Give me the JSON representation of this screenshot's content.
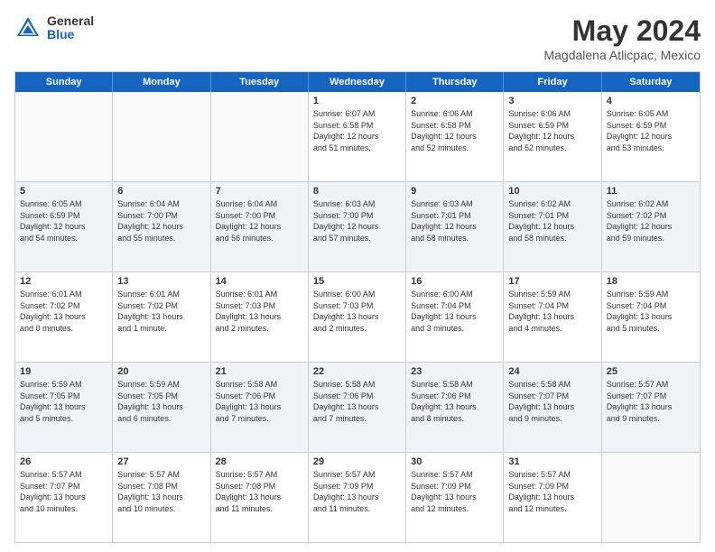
{
  "header": {
    "logo_general": "General",
    "logo_blue": "Blue",
    "month_title": "May 2024",
    "location": "Magdalena Atlicpac, Mexico"
  },
  "calendar": {
    "days_of_week": [
      "Sunday",
      "Monday",
      "Tuesday",
      "Wednesday",
      "Thursday",
      "Friday",
      "Saturday"
    ],
    "rows": [
      {
        "alt": false,
        "cells": [
          {
            "day": "",
            "empty": true,
            "text": ""
          },
          {
            "day": "",
            "empty": true,
            "text": ""
          },
          {
            "day": "",
            "empty": true,
            "text": ""
          },
          {
            "day": "1",
            "empty": false,
            "text": "Sunrise: 6:07 AM\nSunset: 6:58 PM\nDaylight: 12 hours\nand 51 minutes."
          },
          {
            "day": "2",
            "empty": false,
            "text": "Sunrise: 6:06 AM\nSunset: 6:58 PM\nDaylight: 12 hours\nand 52 minutes."
          },
          {
            "day": "3",
            "empty": false,
            "text": "Sunrise: 6:06 AM\nSunset: 6:59 PM\nDaylight: 12 hours\nand 52 minutes."
          },
          {
            "day": "4",
            "empty": false,
            "text": "Sunrise: 6:05 AM\nSunset: 6:59 PM\nDaylight: 12 hours\nand 53 minutes."
          }
        ]
      },
      {
        "alt": true,
        "cells": [
          {
            "day": "5",
            "empty": false,
            "text": "Sunrise: 6:05 AM\nSunset: 6:59 PM\nDaylight: 12 hours\nand 54 minutes."
          },
          {
            "day": "6",
            "empty": false,
            "text": "Sunrise: 6:04 AM\nSunset: 7:00 PM\nDaylight: 12 hours\nand 55 minutes."
          },
          {
            "day": "7",
            "empty": false,
            "text": "Sunrise: 6:04 AM\nSunset: 7:00 PM\nDaylight: 12 hours\nand 56 minutes."
          },
          {
            "day": "8",
            "empty": false,
            "text": "Sunrise: 6:03 AM\nSunset: 7:00 PM\nDaylight: 12 hours\nand 57 minutes."
          },
          {
            "day": "9",
            "empty": false,
            "text": "Sunrise: 6:03 AM\nSunset: 7:01 PM\nDaylight: 12 hours\nand 58 minutes."
          },
          {
            "day": "10",
            "empty": false,
            "text": "Sunrise: 6:02 AM\nSunset: 7:01 PM\nDaylight: 12 hours\nand 58 minutes."
          },
          {
            "day": "11",
            "empty": false,
            "text": "Sunrise: 6:02 AM\nSunset: 7:02 PM\nDaylight: 12 hours\nand 59 minutes."
          }
        ]
      },
      {
        "alt": false,
        "cells": [
          {
            "day": "12",
            "empty": false,
            "text": "Sunrise: 6:01 AM\nSunset: 7:02 PM\nDaylight: 13 hours\nand 0 minutes."
          },
          {
            "day": "13",
            "empty": false,
            "text": "Sunrise: 6:01 AM\nSunset: 7:02 PM\nDaylight: 13 hours\nand 1 minute."
          },
          {
            "day": "14",
            "empty": false,
            "text": "Sunrise: 6:01 AM\nSunset: 7:03 PM\nDaylight: 13 hours\nand 2 minutes."
          },
          {
            "day": "15",
            "empty": false,
            "text": "Sunrise: 6:00 AM\nSunset: 7:03 PM\nDaylight: 13 hours\nand 2 minutes."
          },
          {
            "day": "16",
            "empty": false,
            "text": "Sunrise: 6:00 AM\nSunset: 7:04 PM\nDaylight: 13 hours\nand 3 minutes."
          },
          {
            "day": "17",
            "empty": false,
            "text": "Sunrise: 5:59 AM\nSunset: 7:04 PM\nDaylight: 13 hours\nand 4 minutes."
          },
          {
            "day": "18",
            "empty": false,
            "text": "Sunrise: 5:59 AM\nSunset: 7:04 PM\nDaylight: 13 hours\nand 5 minutes."
          }
        ]
      },
      {
        "alt": true,
        "cells": [
          {
            "day": "19",
            "empty": false,
            "text": "Sunrise: 5:59 AM\nSunset: 7:05 PM\nDaylight: 13 hours\nand 5 minutes."
          },
          {
            "day": "20",
            "empty": false,
            "text": "Sunrise: 5:59 AM\nSunset: 7:05 PM\nDaylight: 13 hours\nand 6 minutes."
          },
          {
            "day": "21",
            "empty": false,
            "text": "Sunrise: 5:58 AM\nSunset: 7:06 PM\nDaylight: 13 hours\nand 7 minutes."
          },
          {
            "day": "22",
            "empty": false,
            "text": "Sunrise: 5:58 AM\nSunset: 7:06 PM\nDaylight: 13 hours\nand 7 minutes."
          },
          {
            "day": "23",
            "empty": false,
            "text": "Sunrise: 5:58 AM\nSunset: 7:06 PM\nDaylight: 13 hours\nand 8 minutes."
          },
          {
            "day": "24",
            "empty": false,
            "text": "Sunrise: 5:58 AM\nSunset: 7:07 PM\nDaylight: 13 hours\nand 9 minutes."
          },
          {
            "day": "25",
            "empty": false,
            "text": "Sunrise: 5:57 AM\nSunset: 7:07 PM\nDaylight: 13 hours\nand 9 minutes."
          }
        ]
      },
      {
        "alt": false,
        "cells": [
          {
            "day": "26",
            "empty": false,
            "text": "Sunrise: 5:57 AM\nSunset: 7:07 PM\nDaylight: 13 hours\nand 10 minutes."
          },
          {
            "day": "27",
            "empty": false,
            "text": "Sunrise: 5:57 AM\nSunset: 7:08 PM\nDaylight: 13 hours\nand 10 minutes."
          },
          {
            "day": "28",
            "empty": false,
            "text": "Sunrise: 5:57 AM\nSunset: 7:08 PM\nDaylight: 13 hours\nand 11 minutes."
          },
          {
            "day": "29",
            "empty": false,
            "text": "Sunrise: 5:57 AM\nSunset: 7:09 PM\nDaylight: 13 hours\nand 11 minutes."
          },
          {
            "day": "30",
            "empty": false,
            "text": "Sunrise: 5:57 AM\nSunset: 7:09 PM\nDaylight: 13 hours\nand 12 minutes."
          },
          {
            "day": "31",
            "empty": false,
            "text": "Sunrise: 5:57 AM\nSunset: 7:09 PM\nDaylight: 13 hours\nand 12 minutes."
          },
          {
            "day": "",
            "empty": true,
            "text": ""
          }
        ]
      }
    ]
  }
}
